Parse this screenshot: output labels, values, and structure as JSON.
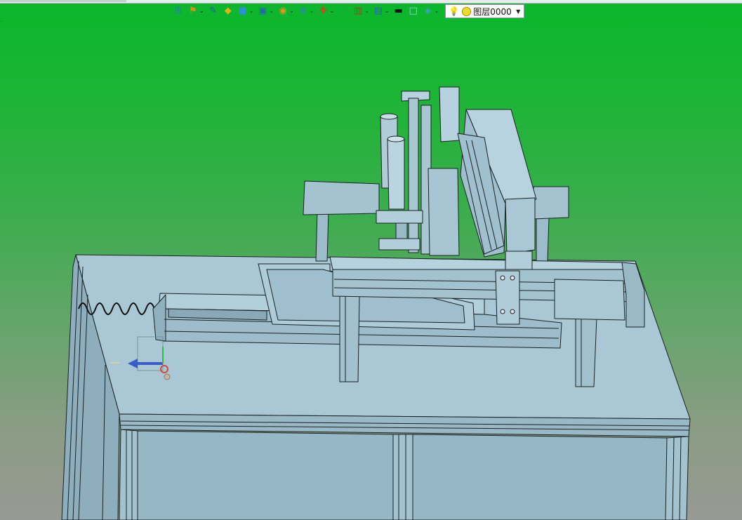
{
  "toolbar": {
    "items": [
      {
        "name": "new-document-icon",
        "glyph": "⊞",
        "color": "#2b78c4",
        "dropdown": false
      },
      {
        "name": "attribute-icon",
        "glyph": "⚑",
        "color": "#d98c1c",
        "dropdown": true
      },
      {
        "name": "pen-icon",
        "glyph": "✎",
        "color": "#1f5ca8",
        "dropdown": false
      },
      {
        "name": "material-icon",
        "glyph": "◆",
        "color": "#e0b419",
        "dropdown": false
      },
      {
        "name": "cube-icon",
        "glyph": "■",
        "color": "#2a8fd6",
        "dropdown": true
      },
      {
        "name": "view-orientation-icon",
        "glyph": "▣",
        "color": "#2466b5",
        "dropdown": true
      },
      {
        "name": "render-mode-icon",
        "glyph": "◉",
        "color": "#e7941a",
        "dropdown": true
      },
      {
        "name": "zoom-icon",
        "glyph": "⊕",
        "color": "#2d7fd0",
        "dropdown": true
      },
      {
        "name": "move-axis-icon",
        "glyph": "✥",
        "color": "#d0431b",
        "dropdown": true
      },
      {
        "name": "fit-view-icon",
        "glyph": "⤢",
        "color": "#2f9b3f",
        "dropdown": false
      },
      {
        "name": "section-view-icon",
        "glyph": "▥",
        "color": "#c7351d",
        "dropdown": true
      },
      {
        "name": "display-settings-icon",
        "glyph": "▤",
        "color": "#2766b8",
        "dropdown": true
      },
      {
        "name": "line-color-icon",
        "glyph": "▬",
        "color": "#111111",
        "dropdown": false
      },
      {
        "name": "fill-color-icon",
        "glyph": "□",
        "color": "#9fd3f0",
        "dropdown": false
      },
      {
        "name": "layer-manager-icon",
        "glyph": "◈",
        "color": "#3aa0c8",
        "dropdown": true
      }
    ],
    "layer": {
      "bulb_icon": "lightbulb-icon",
      "sun_icon": "layer-freeze-icon",
      "name": "图层0000"
    }
  },
  "scene": {
    "background_top": "#0ab62c",
    "background_bottom": "#979a94",
    "model_fill": "#a6c4d2",
    "model_edge": "#1a2124"
  }
}
